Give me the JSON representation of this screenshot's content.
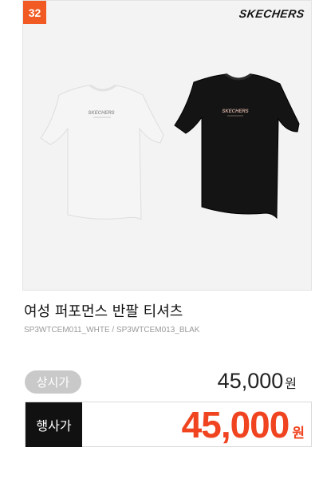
{
  "badge": {
    "rank": "32"
  },
  "brand": {
    "logo_text": "SKECHERS"
  },
  "product": {
    "name": "여성 퍼포먼스 반팔 티셔츠",
    "codes": "SP3WTCEM011_WHTE / SP3WTCEM013_BLAK",
    "variants": [
      {
        "color_name": "white",
        "color": "#f4f4f4",
        "logo_color": "#9a9a9a"
      },
      {
        "color_name": "black",
        "color": "#151515",
        "logo_color": "#c9a79a"
      }
    ]
  },
  "pricing": {
    "regular_label": "상시가",
    "regular_price": "45,000",
    "regular_unit": "원",
    "sale_label": "행사가",
    "sale_price": "45,000",
    "sale_unit": "원"
  },
  "colors": {
    "accent": "#f04420",
    "badge": "#f15a22",
    "label_gray": "#c9c9c9",
    "label_dark": "#111111"
  }
}
